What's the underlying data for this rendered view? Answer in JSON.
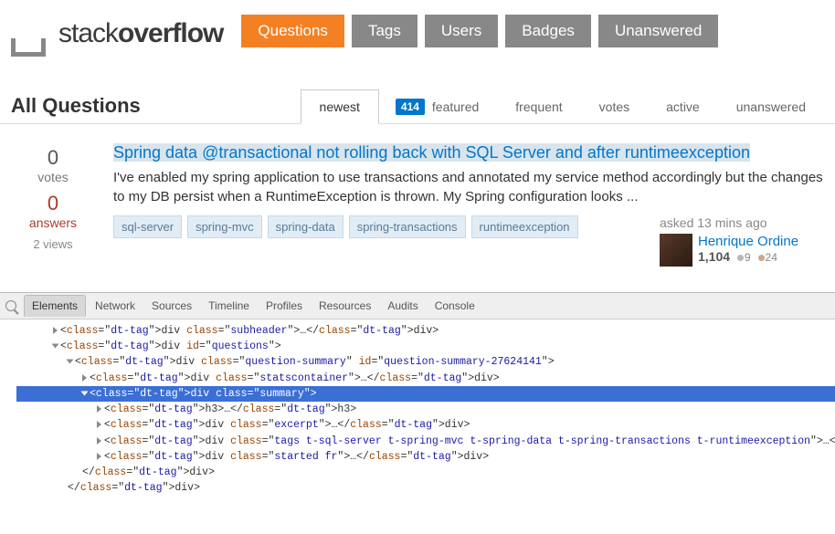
{
  "logo": {
    "word1": "stack",
    "word2": "overflow"
  },
  "nav": [
    "Questions",
    "Tags",
    "Users",
    "Badges",
    "Unanswered"
  ],
  "nav_active": 0,
  "subheader_title": "All Questions",
  "tabs": {
    "newest": "newest",
    "featured": "featured",
    "featured_count": "414",
    "frequent": "frequent",
    "votes": "votes",
    "active": "active",
    "unanswered": "unanswered"
  },
  "question": {
    "votes": "0",
    "votes_lbl": "votes",
    "answers": "0",
    "answers_lbl": "answers",
    "views": "2 views",
    "title": "Spring data @transactional not rolling back with SQL Server and after runtimeexception",
    "excerpt": "I've enabled my spring application to use transactions and annotated my service method accordingly but the changes to my DB persist when a RuntimeException is thrown. My Spring configuration looks ...",
    "tags": [
      "sql-server",
      "spring-mvc",
      "spring-data",
      "spring-transactions",
      "runtimeexception"
    ],
    "asked": "asked 13 mins ago",
    "user": "Henrique Ordine",
    "rep": "1,104",
    "silver": "9",
    "bronze": "24"
  },
  "devtools": {
    "tabs": [
      "Elements",
      "Network",
      "Sources",
      "Timeline",
      "Profiles",
      "Resources",
      "Audits",
      "Console"
    ],
    "dom": {
      "subheader_div": "<div class=\"subheader\">…</div>",
      "questions_open": "<div id=\"questions\">",
      "qsum_open": "<div class=\"question-summary\" id=\"question-summary-27624141\">",
      "stats_div": "<div class=\"statscontainer\">…</div>",
      "summary_open": "<div class=\"summary\">",
      "h3": "<h3>…</h3>",
      "excerpt_div": "<div class=\"excerpt\">…</div>",
      "tags_div": "<div class=\"tags t-sql-server t-spring-mvc t-spring-data t-spring-transactions t-runtimeexception\">…</div>",
      "started_div": "<div class=\"started fr\">…</div>",
      "div_close": "</div>"
    }
  }
}
